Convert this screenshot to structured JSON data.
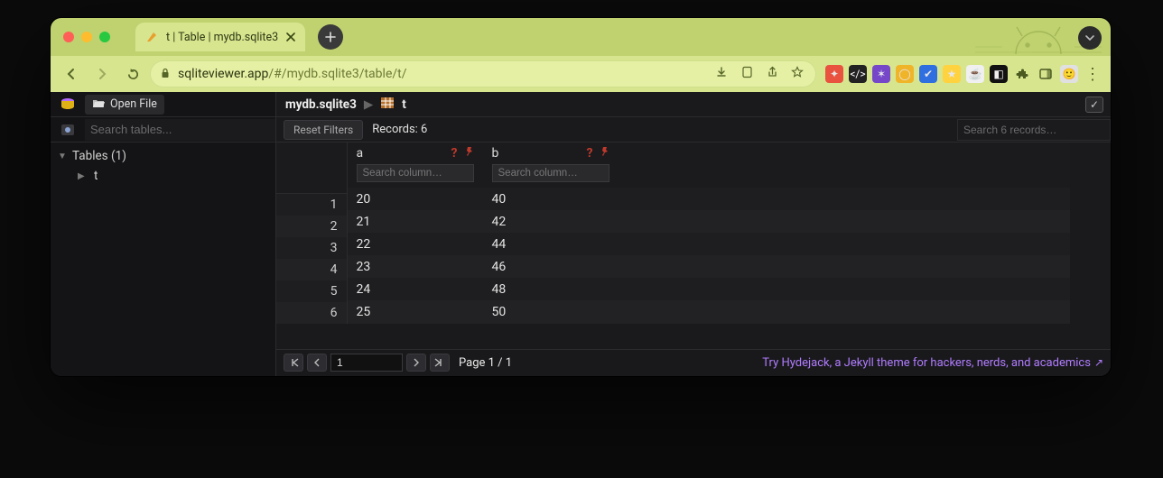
{
  "browser": {
    "tab_title": "t | Table | mydb.sqlite3",
    "url_host": "sqliteviewer.app",
    "url_path": "/#/mydb.sqlite3/table/t/"
  },
  "app": {
    "open_file_label": "Open File",
    "sidebar_search_placeholder": "Search tables...",
    "tables_group_label": "Tables (1)",
    "table_item": "t"
  },
  "crumb": {
    "db": "mydb.sqlite3",
    "table": "t"
  },
  "toolbar": {
    "reset_label": "Reset Filters",
    "records_label": "Records: 6",
    "search_records_placeholder": "Search 6 records…"
  },
  "grid": {
    "columns": [
      {
        "name": "a",
        "search_placeholder": "Search column…"
      },
      {
        "name": "b",
        "search_placeholder": "Search column…"
      }
    ],
    "rows": [
      {
        "n": "1",
        "a": "20",
        "b": "40"
      },
      {
        "n": "2",
        "a": "21",
        "b": "42"
      },
      {
        "n": "3",
        "a": "22",
        "b": "44"
      },
      {
        "n": "4",
        "a": "23",
        "b": "46"
      },
      {
        "n": "5",
        "a": "24",
        "b": "48"
      },
      {
        "n": "6",
        "a": "25",
        "b": "50"
      }
    ]
  },
  "pager": {
    "page_input": "1",
    "page_text": "Page 1 / 1"
  },
  "footer": {
    "try_link": "Try Hydejack, a Jekyll theme for hackers, nerds, and academics"
  }
}
